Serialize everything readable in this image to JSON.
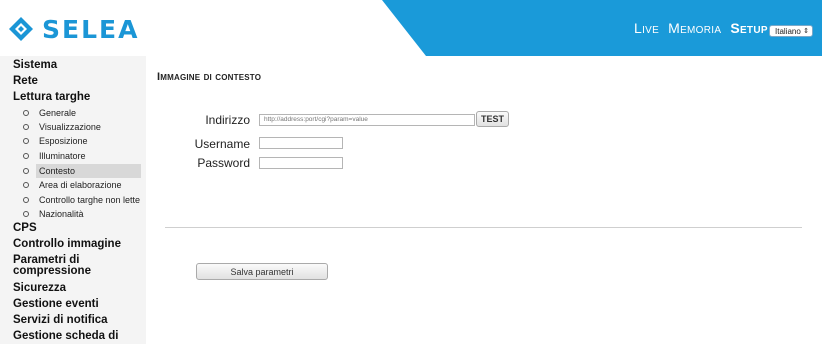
{
  "brand": {
    "name": "SELEA"
  },
  "topnav": {
    "live": "Live",
    "memoria": "Memoria",
    "setup": "Setup"
  },
  "language": {
    "selected": "Italiano"
  },
  "sidebar": {
    "items": [
      {
        "label": "Sistema"
      },
      {
        "label": "Rete"
      },
      {
        "label": "Lettura targhe"
      }
    ],
    "subitems": [
      {
        "label": "Generale"
      },
      {
        "label": "Visualizzazione"
      },
      {
        "label": "Esposizione"
      },
      {
        "label": "Illuminatore"
      },
      {
        "label": "Contesto"
      },
      {
        "label": "Area di elaborazione"
      },
      {
        "label": "Controllo targhe non lette"
      },
      {
        "label": "Nazionalità"
      }
    ],
    "items2": [
      {
        "label": "CPS"
      },
      {
        "label": "Controllo immagine"
      },
      {
        "label": "Parametri di compressione"
      },
      {
        "label": "Sicurezza"
      },
      {
        "label": "Gestione eventi"
      },
      {
        "label": "Servizi di notifica"
      },
      {
        "label": "Gestione scheda di"
      }
    ]
  },
  "main": {
    "title": "Immagine di contesto",
    "address_label": "Indirizzo",
    "address_placeholder": "http://address:port/cgi?param=value",
    "test_button": "TEST",
    "username_label": "Username",
    "password_label": "Password",
    "save_button": "Salva parametri"
  },
  "colors": {
    "accent": "#1b96d6"
  }
}
